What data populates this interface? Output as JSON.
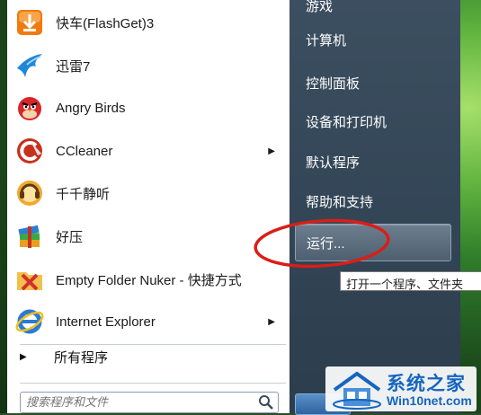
{
  "programs": [
    {
      "label": "快车(FlashGet)3",
      "icon": "flashget-icon",
      "submenu": false
    },
    {
      "label": "迅雷7",
      "icon": "thunder-icon",
      "submenu": false
    },
    {
      "label": "Angry Birds",
      "icon": "angry-birds-icon",
      "submenu": false
    },
    {
      "label": "CCleaner",
      "icon": "ccleaner-icon",
      "submenu": true
    },
    {
      "label": "千千静听",
      "icon": "ttplayer-icon",
      "submenu": false
    },
    {
      "label": "好压",
      "icon": "haozip-icon",
      "submenu": false
    },
    {
      "label": "Empty Folder Nuker - 快捷方式",
      "icon": "empty-folder-nuker-icon",
      "submenu": false
    },
    {
      "label": "Internet Explorer",
      "icon": "internet-explorer-icon",
      "submenu": true
    }
  ],
  "all_programs_label": "所有程序",
  "search": {
    "placeholder": "搜索程序和文件"
  },
  "right_items": [
    {
      "label": "游戏"
    },
    {
      "label": "计算机"
    },
    {
      "label": "控制面板"
    },
    {
      "label": "设备和打印机"
    },
    {
      "label": "默认程序"
    },
    {
      "label": "帮助和支持"
    },
    {
      "label": "运行..."
    }
  ],
  "tooltip": "打开一个程序、文件夹",
  "watermark": {
    "title": "系统之家",
    "url": "Win10net.com"
  },
  "colors": {
    "accent": "#1565c0",
    "annotation": "#d91e18",
    "right_pane": "#334657"
  }
}
